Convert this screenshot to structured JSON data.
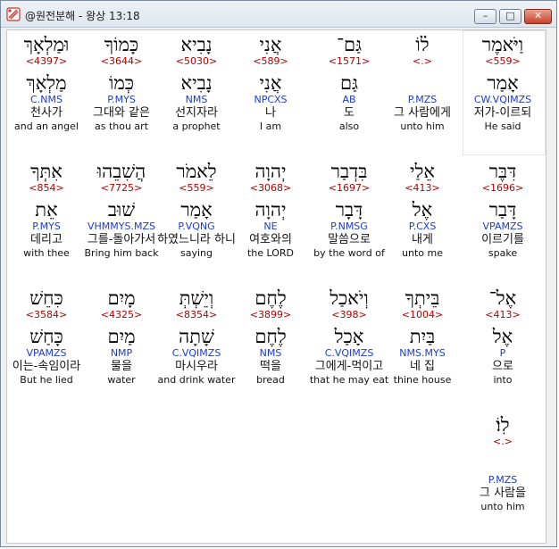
{
  "window": {
    "title": "@원전분해 - 왕상 13:18",
    "min_label": "–",
    "max_label": "□",
    "close_label": "✕"
  },
  "icons": {
    "app": "bible-app-icon"
  },
  "rows": [
    {
      "words": [
        {
          "heb": "וַיֹּאמֶר",
          "strong": "<559>",
          "root": "אָמַר",
          "parse": "CW.VQIMZS",
          "kor": "저가-이르되",
          "eng": "He said"
        },
        {
          "heb": "ל֗וֹ",
          "strong": "<.>",
          "root": "",
          "parse": "P.MZS",
          "kor": "그 사람에게",
          "eng": "unto him"
        },
        {
          "heb": "גַּם־",
          "strong": "<1571>",
          "root": "גַּם",
          "parse": "AB",
          "kor": "도",
          "eng": "also"
        },
        {
          "heb": "אֲנִי",
          "strong": "<589>",
          "root": "אֲנִי",
          "parse": "NPCXS",
          "kor": "나",
          "eng": "I am"
        },
        {
          "heb": "נָבִיא",
          "strong": "<5030>",
          "root": "נָבִיא",
          "parse": "NMS",
          "kor": "선지자라",
          "eng": "a prophet"
        },
        {
          "heb": "כָּמוֹךָ",
          "strong": "<3644>",
          "root": "כְּמוֹ",
          "parse": "P.MYS",
          "kor": "그대와 같은",
          "eng": "as thou art"
        },
        {
          "heb": "וּמַלְאָךְ",
          "strong": "<4397>",
          "root": "מַלְאָךְ",
          "parse": "C.NMS",
          "kor": "천사가",
          "eng": "and an angel"
        }
      ]
    },
    {
      "words": [
        {
          "heb": "דִּבֶּר",
          "strong": "<1696>",
          "root": "דָּבַר",
          "parse": "VPAMZS",
          "kor": "이르기를",
          "eng": "spake"
        },
        {
          "heb": "אֵלַי",
          "strong": "<413>",
          "root": "אֶל",
          "parse": "P.CXS",
          "kor": "내게",
          "eng": "unto me"
        },
        {
          "heb": "בִּדְבַר",
          "strong": "<1697>",
          "root": "דָּבָר",
          "parse": "P.NMSG",
          "kor": "말씀으로",
          "eng": "by the word of"
        },
        {
          "heb": "יְהוָה",
          "strong": "<3068>",
          "root": "יְהוָה",
          "parse": "NE",
          "kor": "여호와의",
          "eng": "the LORD"
        },
        {
          "heb": "לֵאמֹר",
          "strong": "<559>",
          "root": "אָמַר",
          "parse": "P.VQNG",
          "kor": "하였느니라 하니",
          "eng": "saying"
        },
        {
          "heb": "הֲשִׁבֵהוּ",
          "strong": "<7725>",
          "root": "שׁוּב",
          "parse": "VHMMYS.MZS",
          "kor": "그를-돌아가서",
          "eng": "Bring him back"
        },
        {
          "heb": "אִתְּךָ",
          "strong": "<854>",
          "root": "אֵת",
          "parse": "P.MYS",
          "kor": "데리고",
          "eng": "with thee"
        }
      ]
    },
    {
      "words": [
        {
          "heb": "אֶל־",
          "strong": "<413>",
          "root": "אֶל",
          "parse": "P",
          "kor": "으로",
          "eng": "into"
        },
        {
          "heb": "בֵּיתְךָ",
          "strong": "<1004>",
          "root": "בַּיִת",
          "parse": "NMS.MYS",
          "kor": "네 집",
          "eng": "thine house"
        },
        {
          "heb": "וְיֹאכַל",
          "strong": "<398>",
          "root": "אָכַל",
          "parse": "C.VQIMZS",
          "kor": "그에게-먹이고",
          "eng": "that he may eat"
        },
        {
          "heb": "לֶחֶם",
          "strong": "<3899>",
          "root": "לֶחֶם",
          "parse": "NMS",
          "kor": "떡을",
          "eng": "bread"
        },
        {
          "heb": "וְיֵשְׁתְּ",
          "strong": "<8354>",
          "root": "שָׁתָה",
          "parse": "C.VQIMZS",
          "kor": "마시우라",
          "eng": "and drink water"
        },
        {
          "heb": "מָיִם",
          "strong": "<4325>",
          "root": "מַיִם",
          "parse": "NMP",
          "kor": "물을",
          "eng": "water"
        },
        {
          "heb": "כִּחֵשׁ",
          "strong": "<3584>",
          "root": "כָּחַשׁ",
          "parse": "VPAMZS",
          "kor": "이는-속임이라",
          "eng": "But he lied"
        }
      ]
    },
    {
      "words": [
        {
          "heb": "לֽוֹ׃",
          "strong": "<.>",
          "root": "",
          "parse": "P.MZS",
          "kor": "그 사람을",
          "eng": "unto him"
        }
      ]
    }
  ]
}
